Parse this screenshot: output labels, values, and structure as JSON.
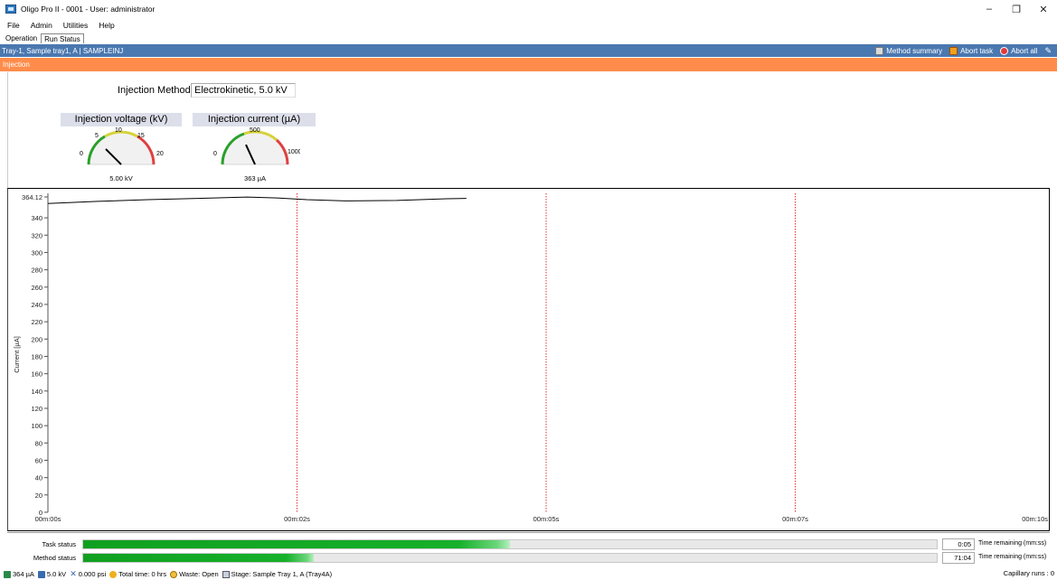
{
  "window": {
    "title": "Oligo Pro II - 0001 - User: administrator",
    "minimize": "–",
    "restore": "❐",
    "close": "✕"
  },
  "menu": [
    "File",
    "Admin",
    "Utilities",
    "Help"
  ],
  "tabs": [
    "Operation",
    "Run Status"
  ],
  "header": {
    "crumb": "Tray-1, Sample tray1, A  |  SAMPLEINJ",
    "method_summary": "Method summary",
    "abort_task": "Abort task",
    "abort_all": "Abort all",
    "pen_icon": "pen-icon"
  },
  "section": {
    "title": "Injection"
  },
  "injection": {
    "method_label": "Injection Method",
    "method_value": "Electrokinetic, 5.0 kV",
    "voltage_gauge": {
      "title": "Injection voltage (kV)",
      "ticks": [
        "0",
        "5",
        "10",
        "15",
        "20"
      ],
      "value_text": "5.00 kV",
      "value": 5.0,
      "max": 20
    },
    "current_gauge": {
      "title": "Injection current (µA)",
      "ticks": [
        "0",
        "500",
        "1000"
      ],
      "value_text": "363 µA",
      "value": 363,
      "max": 1000
    }
  },
  "chart_data": {
    "type": "line",
    "ylabel": "Current [µA]",
    "xlabel": "",
    "ylim": [
      0,
      364.12
    ],
    "y_ticks": [
      "0",
      "20",
      "40",
      "60",
      "80",
      "100",
      "120",
      "140",
      "160",
      "180",
      "200",
      "220",
      "240",
      "260",
      "280",
      "300",
      "320",
      "340",
      "364.12"
    ],
    "x_ticks": [
      "00m:00s",
      "00m:02s",
      "00m:05s",
      "00m:07s",
      "00m:10s"
    ],
    "xlim_s": [
      0,
      10
    ],
    "markers_s": [
      2.5,
      5.0,
      7.5
    ],
    "series": [
      {
        "x_s": [
          0.0,
          0.5,
          1.0,
          1.5,
          2.0,
          2.3,
          2.6,
          3.0,
          3.5,
          4.0,
          4.2
        ],
        "y": [
          356.5,
          359.0,
          361.0,
          362.5,
          364.0,
          363.0,
          361.0,
          359.5,
          360.0,
          362.0,
          362.5
        ]
      }
    ],
    "grid": false
  },
  "status": {
    "task_label": "Task status",
    "task_progress": 0.5,
    "task_time": "0:05",
    "method_label": "Method status",
    "method_progress": 0.27,
    "method_time": "71:04",
    "time_unit": "Time remaining (mm:ss)"
  },
  "bottom": {
    "current": "364 µA",
    "voltage": "5.0 kV",
    "pressure": "0.000 psi",
    "total_time": "Total time: 0 hrs",
    "waste": "Waste: Open",
    "stage": "Stage: Sample Tray 1, A (Tray4A)",
    "capillary_runs": "Capillary runs : 0"
  },
  "colors": {
    "blue_header": "#4a78b0",
    "orange_header": "#ff8c4a",
    "progress_green": "#10a020",
    "marker_red": "#e03030"
  }
}
